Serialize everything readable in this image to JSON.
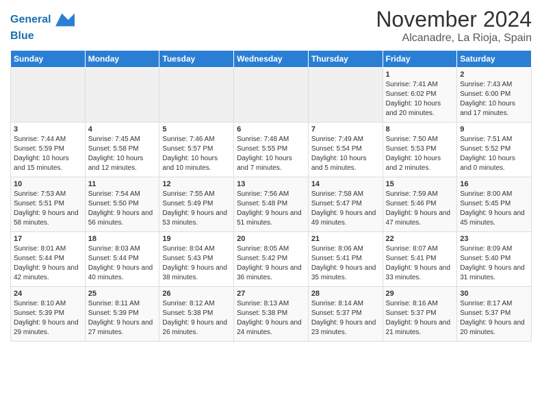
{
  "header": {
    "logo_line1": "General",
    "logo_line2": "Blue",
    "month": "November 2024",
    "location": "Alcanadre, La Rioja, Spain"
  },
  "weekdays": [
    "Sunday",
    "Monday",
    "Tuesday",
    "Wednesday",
    "Thursday",
    "Friday",
    "Saturday"
  ],
  "weeks": [
    [
      {
        "day": "",
        "info": ""
      },
      {
        "day": "",
        "info": ""
      },
      {
        "day": "",
        "info": ""
      },
      {
        "day": "",
        "info": ""
      },
      {
        "day": "",
        "info": ""
      },
      {
        "day": "1",
        "info": "Sunrise: 7:41 AM\nSunset: 6:02 PM\nDaylight: 10 hours and 20 minutes."
      },
      {
        "day": "2",
        "info": "Sunrise: 7:43 AM\nSunset: 6:00 PM\nDaylight: 10 hours and 17 minutes."
      }
    ],
    [
      {
        "day": "3",
        "info": "Sunrise: 7:44 AM\nSunset: 5:59 PM\nDaylight: 10 hours and 15 minutes."
      },
      {
        "day": "4",
        "info": "Sunrise: 7:45 AM\nSunset: 5:58 PM\nDaylight: 10 hours and 12 minutes."
      },
      {
        "day": "5",
        "info": "Sunrise: 7:46 AM\nSunset: 5:57 PM\nDaylight: 10 hours and 10 minutes."
      },
      {
        "day": "6",
        "info": "Sunrise: 7:48 AM\nSunset: 5:55 PM\nDaylight: 10 hours and 7 minutes."
      },
      {
        "day": "7",
        "info": "Sunrise: 7:49 AM\nSunset: 5:54 PM\nDaylight: 10 hours and 5 minutes."
      },
      {
        "day": "8",
        "info": "Sunrise: 7:50 AM\nSunset: 5:53 PM\nDaylight: 10 hours and 2 minutes."
      },
      {
        "day": "9",
        "info": "Sunrise: 7:51 AM\nSunset: 5:52 PM\nDaylight: 10 hours and 0 minutes."
      }
    ],
    [
      {
        "day": "10",
        "info": "Sunrise: 7:53 AM\nSunset: 5:51 PM\nDaylight: 9 hours and 58 minutes."
      },
      {
        "day": "11",
        "info": "Sunrise: 7:54 AM\nSunset: 5:50 PM\nDaylight: 9 hours and 56 minutes."
      },
      {
        "day": "12",
        "info": "Sunrise: 7:55 AM\nSunset: 5:49 PM\nDaylight: 9 hours and 53 minutes."
      },
      {
        "day": "13",
        "info": "Sunrise: 7:56 AM\nSunset: 5:48 PM\nDaylight: 9 hours and 51 minutes."
      },
      {
        "day": "14",
        "info": "Sunrise: 7:58 AM\nSunset: 5:47 PM\nDaylight: 9 hours and 49 minutes."
      },
      {
        "day": "15",
        "info": "Sunrise: 7:59 AM\nSunset: 5:46 PM\nDaylight: 9 hours and 47 minutes."
      },
      {
        "day": "16",
        "info": "Sunrise: 8:00 AM\nSunset: 5:45 PM\nDaylight: 9 hours and 45 minutes."
      }
    ],
    [
      {
        "day": "17",
        "info": "Sunrise: 8:01 AM\nSunset: 5:44 PM\nDaylight: 9 hours and 42 minutes."
      },
      {
        "day": "18",
        "info": "Sunrise: 8:03 AM\nSunset: 5:44 PM\nDaylight: 9 hours and 40 minutes."
      },
      {
        "day": "19",
        "info": "Sunrise: 8:04 AM\nSunset: 5:43 PM\nDaylight: 9 hours and 38 minutes."
      },
      {
        "day": "20",
        "info": "Sunrise: 8:05 AM\nSunset: 5:42 PM\nDaylight: 9 hours and 36 minutes."
      },
      {
        "day": "21",
        "info": "Sunrise: 8:06 AM\nSunset: 5:41 PM\nDaylight: 9 hours and 35 minutes."
      },
      {
        "day": "22",
        "info": "Sunrise: 8:07 AM\nSunset: 5:41 PM\nDaylight: 9 hours and 33 minutes."
      },
      {
        "day": "23",
        "info": "Sunrise: 8:09 AM\nSunset: 5:40 PM\nDaylight: 9 hours and 31 minutes."
      }
    ],
    [
      {
        "day": "24",
        "info": "Sunrise: 8:10 AM\nSunset: 5:39 PM\nDaylight: 9 hours and 29 minutes."
      },
      {
        "day": "25",
        "info": "Sunrise: 8:11 AM\nSunset: 5:39 PM\nDaylight: 9 hours and 27 minutes."
      },
      {
        "day": "26",
        "info": "Sunrise: 8:12 AM\nSunset: 5:38 PM\nDaylight: 9 hours and 26 minutes."
      },
      {
        "day": "27",
        "info": "Sunrise: 8:13 AM\nSunset: 5:38 PM\nDaylight: 9 hours and 24 minutes."
      },
      {
        "day": "28",
        "info": "Sunrise: 8:14 AM\nSunset: 5:37 PM\nDaylight: 9 hours and 23 minutes."
      },
      {
        "day": "29",
        "info": "Sunrise: 8:16 AM\nSunset: 5:37 PM\nDaylight: 9 hours and 21 minutes."
      },
      {
        "day": "30",
        "info": "Sunrise: 8:17 AM\nSunset: 5:37 PM\nDaylight: 9 hours and 20 minutes."
      }
    ]
  ]
}
